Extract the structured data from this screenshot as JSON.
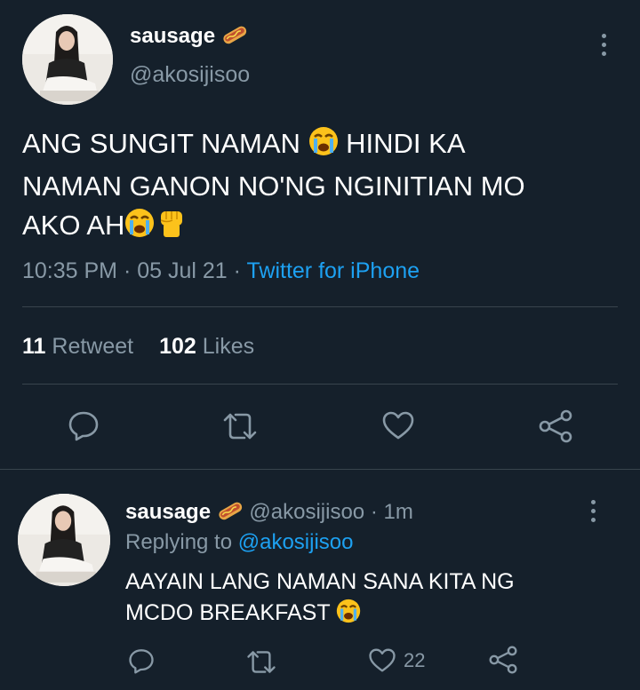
{
  "tweet": {
    "display_name": "sausage",
    "name_emoji": "hotdog-emoji",
    "handle": "@akosijisoo",
    "text_line1_a": "ANG SUNGIT NAMAN",
    "text_line1_b": "HINDI KA",
    "text_line2": "NAMAN GANON NO'NG NGINITIAN MO",
    "text_line3": "AKO AH",
    "time": "10:35 PM",
    "sep1": "·",
    "date": "05 Jul 21",
    "sep2": "·",
    "source": "Twitter for iPhone",
    "retweet_count": "11",
    "retweet_label": "Retweet",
    "like_count": "102",
    "like_label": "Likes"
  },
  "reply": {
    "display_name": "sausage",
    "handle": "@akosijisoo",
    "sep": "·",
    "age": "1m",
    "replying_prefix": "Replying to",
    "replying_to": "@akosijisoo",
    "text_line1": "AAYAIN LANG NAMAN SANA KITA NG",
    "text_line2": "MCDO BREAKFAST",
    "like_count": "22"
  },
  "colors": {
    "background": "#15202b",
    "muted": "#8899a6",
    "link": "#1da1f2",
    "divider": "#38444d"
  },
  "icons": [
    "hotdog-emoji",
    "loudly-crying-face-emoji",
    "raised-fist-emoji",
    "reply-icon",
    "retweet-icon",
    "heart-icon",
    "share-icon",
    "more-options-icon"
  ]
}
